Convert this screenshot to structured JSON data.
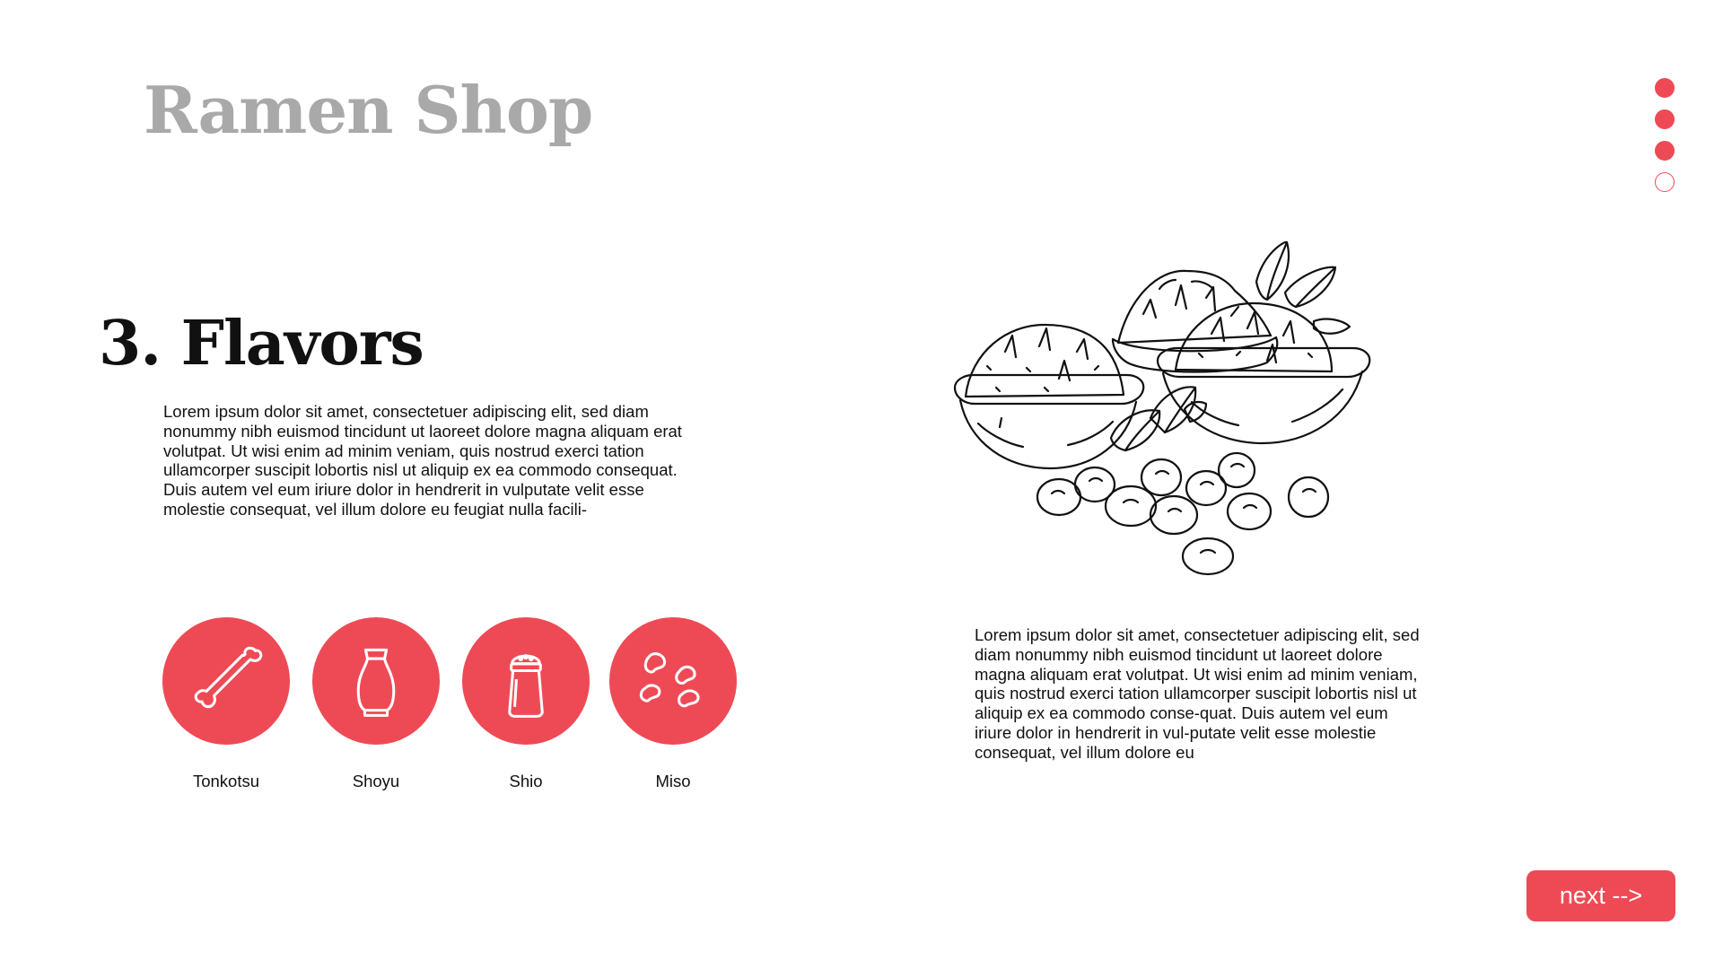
{
  "header": {
    "brand": "Ramen Shop"
  },
  "progress": {
    "current": 3,
    "total": 4,
    "filled_color": "#ee4a55"
  },
  "section": {
    "title": "3. Flavors",
    "intro": "Lorem ipsum dolor sit amet, consectetuer adipiscing elit, sed diam nonummy nibh euismod tincidunt ut laoreet dolore magna aliquam erat volutpat. Ut wisi enim ad minim veniam, quis nostrud exerci tation ullamcorper suscipit lobortis nisl ut aliquip ex ea commodo consequat. Duis autem vel eum iriure dolor in hendrerit in vulputate velit esse molestie consequat, vel illum dolore eu feugiat nulla facili-",
    "detail": "Lorem ipsum dolor sit amet, consectetuer adipiscing elit, sed diam nonummy nibh euismod tincidunt ut laoreet dolore magna aliquam erat volutpat. Ut wisi enim ad minim veniam, quis nostrud exerci tation ullamcorper suscipit lobortis nisl ut aliquip ex ea commodo conse-quat. Duis autem vel eum iriure dolor in hendrerit in vul-putate velit esse molestie consequat, vel illum dolore eu"
  },
  "flavors": [
    {
      "label": "Tonkotsu",
      "icon": "bone-icon"
    },
    {
      "label": "Shoyu",
      "icon": "bottle-icon"
    },
    {
      "label": "Shio",
      "icon": "salt-shaker-icon"
    },
    {
      "label": "Miso",
      "icon": "beans-icon"
    }
  ],
  "illustration": {
    "icon": "miso-bowls-illustration"
  },
  "navigation": {
    "next_label": "next -->"
  },
  "colors": {
    "accent": "#ee4a55",
    "brand_text": "#a9a9a9",
    "body_text": "#111111"
  }
}
